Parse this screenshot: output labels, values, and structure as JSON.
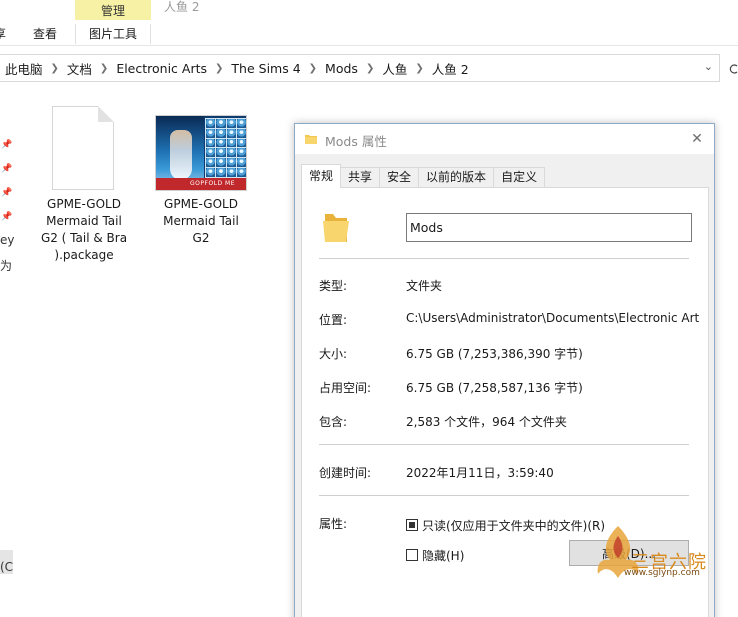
{
  "ribbon": {
    "context_label": "管理",
    "context_title": "人鱼 2",
    "tab_partial": "享",
    "tab_view": "查看",
    "tab_picture_tools": "图片工具"
  },
  "address": {
    "crumbs": [
      "此电脑",
      "文档",
      "Electronic Arts",
      "The Sims 4",
      "Mods",
      "人鱼",
      "人鱼 2"
    ]
  },
  "nav": {
    "frag_1": "ey",
    "frag_2": "为",
    "frag_3": "(C"
  },
  "files": [
    {
      "name": "GPME-GOLD Mermaid Tail G2 ( Tail & Bra ).package",
      "line1": "GPME-GOLD",
      "line2": "Mermaid Tail",
      "line3": "G2 ( Tail & Bra",
      "line4": ").package"
    },
    {
      "name": "GPME-GOLD Mermaid Tail G2",
      "line1": "GPME-GOLD",
      "line2": "Mermaid Tail",
      "line3": "G2",
      "thumb_band": "GOPFOLD ME"
    }
  ],
  "dialog": {
    "title": "Mods 属性",
    "tabs": [
      "常规",
      "共享",
      "安全",
      "以前的版本",
      "自定义"
    ],
    "active_tab": "常规",
    "name_value": "Mods",
    "rows": {
      "type_label": "类型:",
      "type_value": "文件夹",
      "location_label": "位置:",
      "location_value": "C:\\Users\\Administrator\\Documents\\Electronic Art",
      "size_label": "大小:",
      "size_value": "6.75 GB (7,253,386,390 字节)",
      "disk_label": "占用空间:",
      "disk_value": "6.75 GB (7,258,587,136 字节)",
      "contains_label": "包含:",
      "contains_value": "2,583 个文件，964 个文件夹",
      "created_label": "创建时间:",
      "created_value": "2022年1月11日，3:59:40",
      "attributes_label": "属性:"
    },
    "readonly_label": "只读(仅应用于文件夹中的文件)(R)",
    "hidden_label": "隐藏(H)",
    "advanced_label": "高级(D)..."
  },
  "watermark": {
    "text": "三宫六院",
    "url": "www.sglynp.com"
  },
  "colors": {
    "context_tab": "#f7f1a6",
    "folder": "#f3c64f",
    "dialog_bg": "#f0f0f0"
  }
}
